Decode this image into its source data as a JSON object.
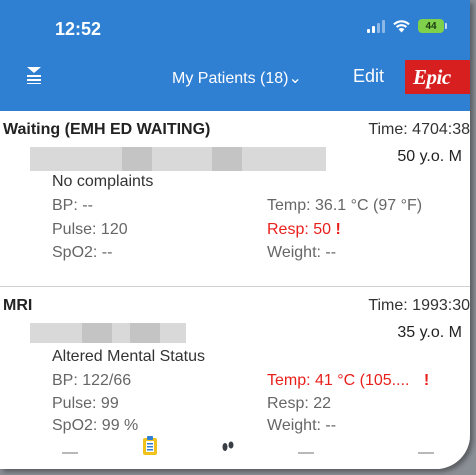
{
  "status_bar": {
    "time": "12:52",
    "battery": "44"
  },
  "nav": {
    "title": "My Patients (18)⌄",
    "edit": "Edit",
    "logo": "Epic"
  },
  "patients": [
    {
      "location": "Waiting (EMH ED WAITING)",
      "time": "Time: 4704:38",
      "age_sex": "50 y.o. M",
      "complaint": "No complaints",
      "bp": "BP: --",
      "pulse": "Pulse: 120",
      "spo2": "SpO2: --",
      "temp": "Temp: 36.1 °C (97 °F)",
      "resp": "Resp: 50",
      "resp_alert": "!",
      "weight": "Weight: --"
    },
    {
      "location": "MRI",
      "time": "Time: 1993:30",
      "age_sex": "35 y.o. M",
      "complaint": "Altered Mental Status",
      "bp": "BP: 122/66",
      "pulse": "Pulse: 99",
      "spo2": "SpO2: 99 %",
      "temp": "Temp: 41 °C (105....",
      "temp_alert": "!",
      "resp": "Resp: 22",
      "weight": "Weight: --"
    }
  ],
  "tabbar": {
    "icons": [
      "clipboard-icon",
      "footprints-icon"
    ]
  },
  "colors": {
    "header_blue": "#2f7fd3",
    "epic_red": "#d81f1f",
    "alert_red": "#e8201c",
    "battery_green": "#7fd04b"
  }
}
